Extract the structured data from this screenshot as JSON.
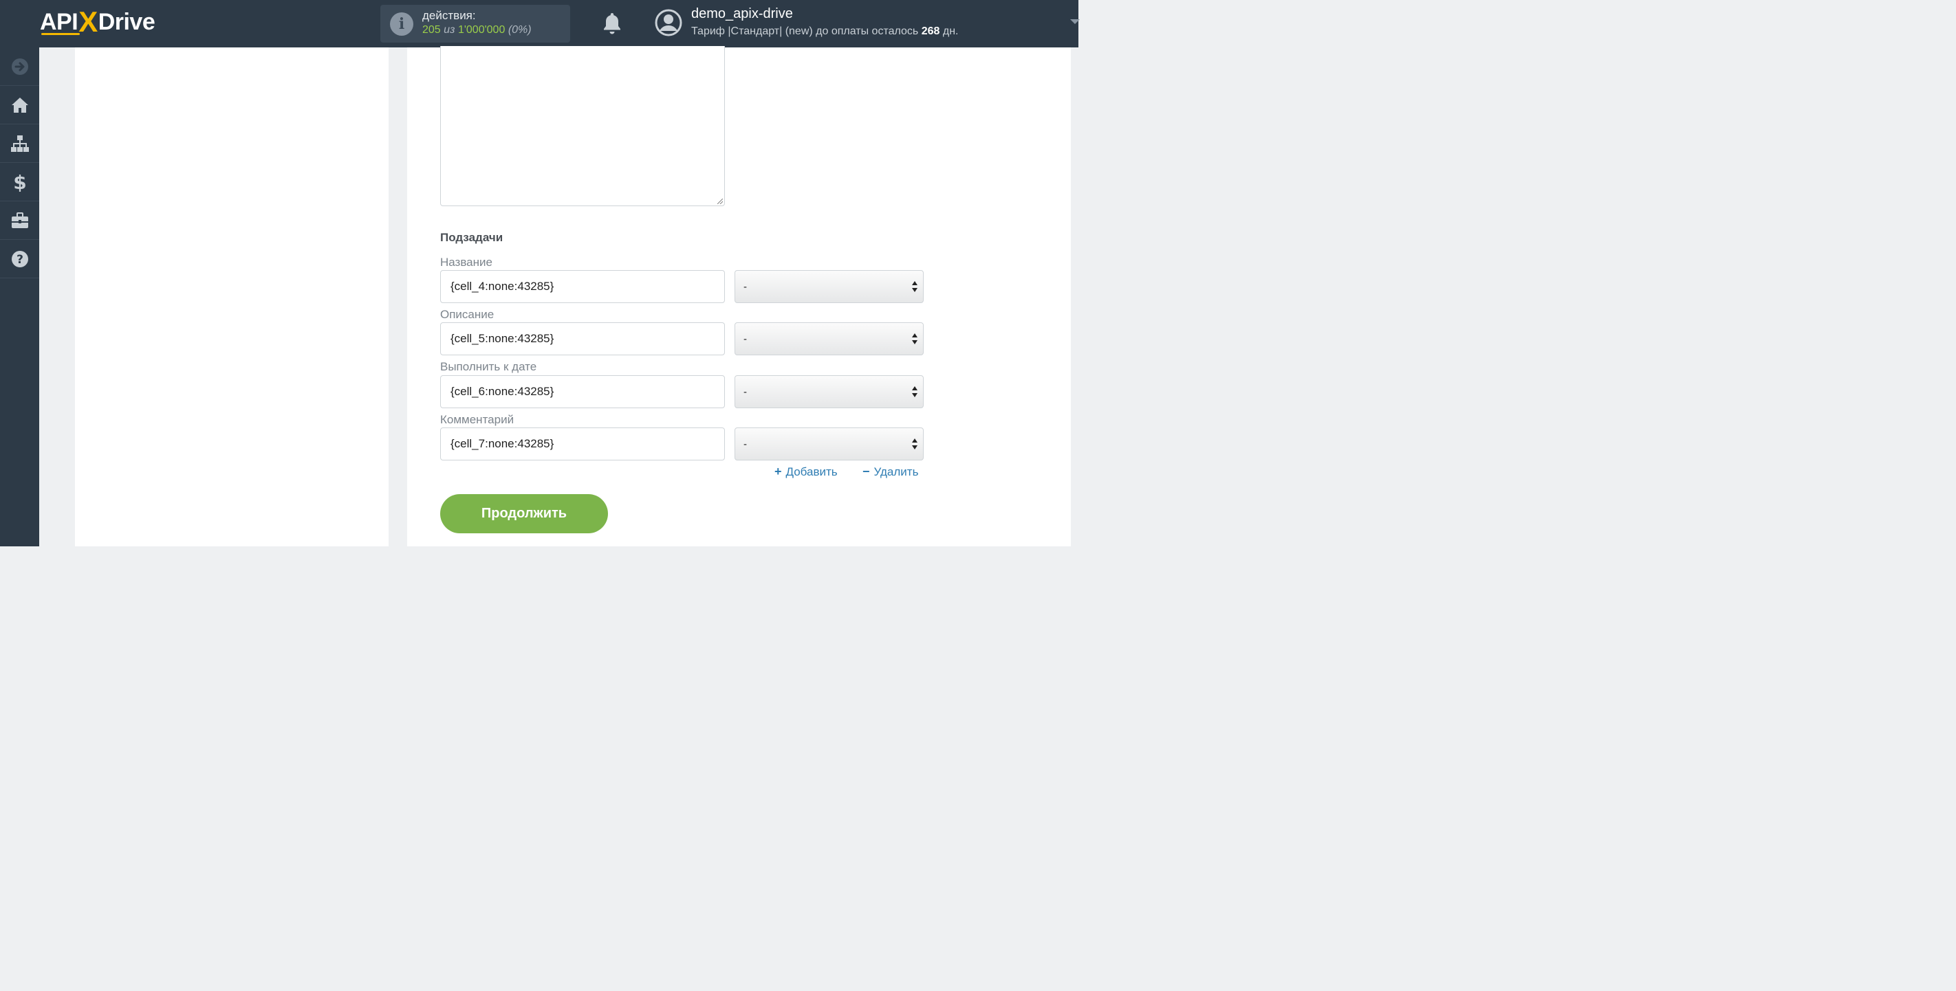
{
  "header": {
    "logo": {
      "part1": "API",
      "part2": "X",
      "part3": "Drive"
    },
    "actions": {
      "label": "действия:",
      "used": "205",
      "of_text": "из",
      "limit": "1'000'000",
      "percent": "(0%)"
    },
    "user": {
      "name": "demo_apix-drive",
      "plan_prefix": "Тариф |Стандарт| (new) до оплаты осталось",
      "days": "268",
      "days_suffix": "дн."
    }
  },
  "sidebar": {
    "items": [
      {
        "icon": "arrow-right-circle-icon"
      },
      {
        "icon": "home-icon"
      },
      {
        "icon": "sitemap-icon"
      },
      {
        "icon": "dollar-icon"
      },
      {
        "icon": "briefcase-icon"
      },
      {
        "icon": "help-icon"
      }
    ]
  },
  "form": {
    "subtasks_title": "Подзадачи",
    "fields": [
      {
        "label": "Название",
        "value": "{cell_4:none:43285}",
        "select": "-"
      },
      {
        "label": "Описание",
        "value": "{cell_5:none:43285}",
        "select": "-"
      },
      {
        "label": "Выполнить к дате",
        "value": "{cell_6:none:43285}",
        "select": "-"
      },
      {
        "label": "Комментарий",
        "value": "{cell_7:none:43285}",
        "select": "-"
      }
    ],
    "add_label": "Добавить",
    "remove_label": "Удалить",
    "continue_label": "Продолжить"
  },
  "colors": {
    "topbar": "#2d3a47",
    "accent_green": "#7cb44a",
    "link_blue": "#2f7db3",
    "logo_yellow": "#f5b800"
  }
}
